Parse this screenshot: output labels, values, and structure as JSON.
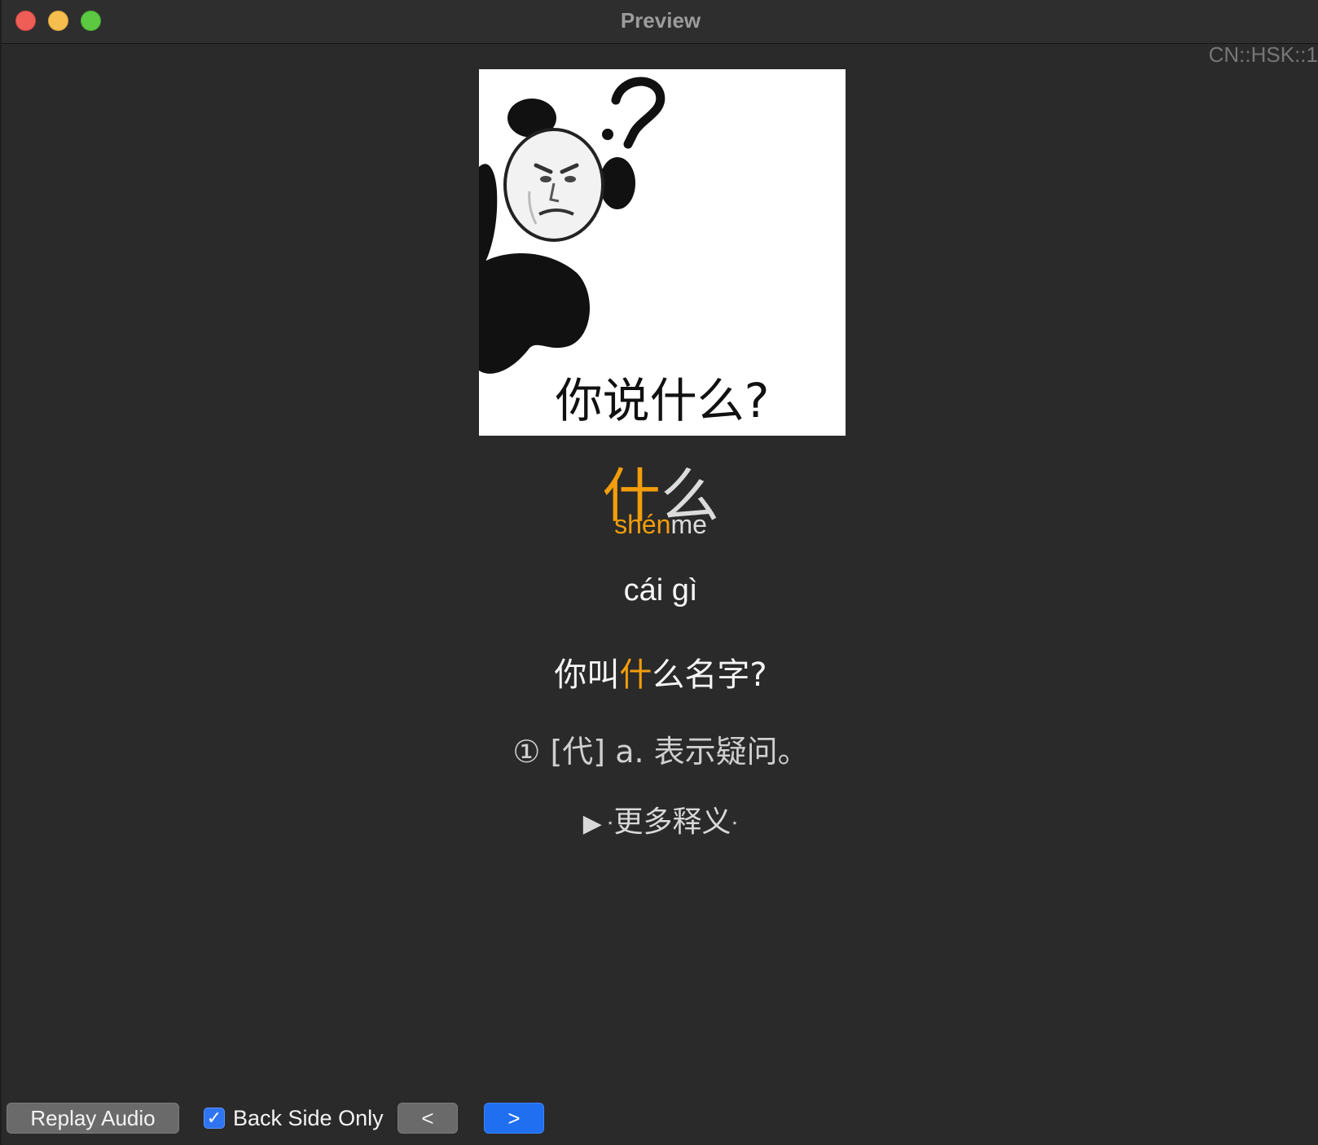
{
  "window": {
    "title": "Preview"
  },
  "deck_tag": "CN::HSK::1",
  "card": {
    "image_caption": "你说什么?",
    "headword": {
      "highlight": "什",
      "rest": "么"
    },
    "pinyin": {
      "highlight": "shén",
      "rest": "me"
    },
    "alt_reading": "cái gì",
    "example": {
      "before": "你叫",
      "highlight": "什",
      "after": "么名字?"
    },
    "definition": "① [代] a. 表示疑问。",
    "more": {
      "arrow": "▶",
      "star": "⋆",
      "label": "更多释义"
    }
  },
  "controls": {
    "replay_audio": "Replay Audio",
    "back_side_only": {
      "label": "Back Side Only",
      "checked": true,
      "mark": "✓"
    },
    "prev": "<",
    "next": ">"
  },
  "colors": {
    "highlight": "#f29d0b",
    "accent_button": "#1f6ff0"
  }
}
